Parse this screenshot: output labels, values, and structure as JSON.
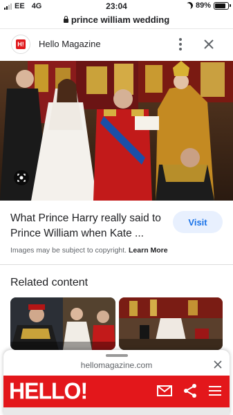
{
  "status_bar": {
    "carrier": "EE",
    "network": "4G",
    "time": "23:04",
    "battery": "89%",
    "battery_level": 0.89
  },
  "url_bar": {
    "query": "prince william wedding"
  },
  "source": {
    "logo_text": "H!",
    "name": "Hello Magazine"
  },
  "result": {
    "title": "What Prince Harry really said to Prince William when Kate ...",
    "visit_label": "Visit",
    "copyright_text": "Images may be subject to copyright.",
    "learn_more_label": "Learn More"
  },
  "related": {
    "heading": "Related content"
  },
  "sheet": {
    "domain": "hellomagazine.com",
    "brand": "HELLO!"
  },
  "colors": {
    "hello_red": "#e3171b",
    "visit_blue": "#1a73e8",
    "visit_bg": "#e8f0fe"
  },
  "icons": [
    "lock-icon",
    "kebab-menu-icon",
    "close-icon",
    "lens-icon",
    "mail-icon",
    "share-icon",
    "hamburger-menu-icon"
  ]
}
